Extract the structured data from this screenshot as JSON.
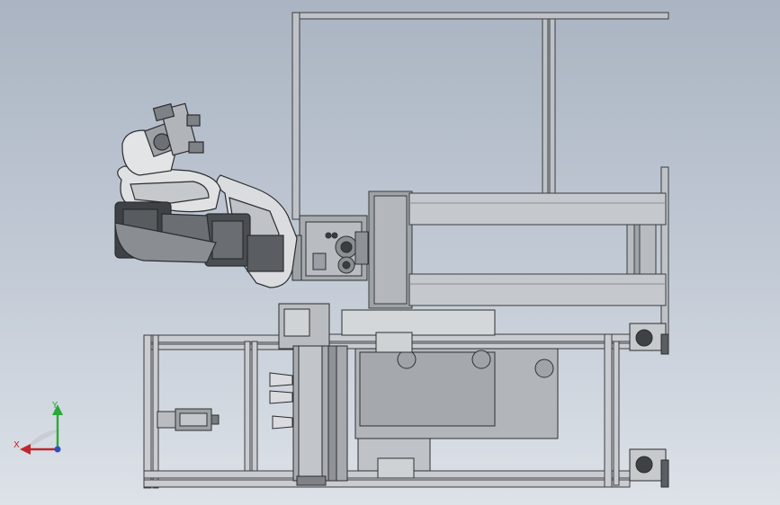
{
  "triad": {
    "x_label": "X",
    "y_label": "Y",
    "x_color": "#c0282d",
    "y_color": "#2aa838",
    "z_color": "#2d4fc4"
  },
  "scene": {
    "background_top": "#aab4c2",
    "background_bottom": "#dde2e8",
    "icon": "cad-assembly-view"
  }
}
